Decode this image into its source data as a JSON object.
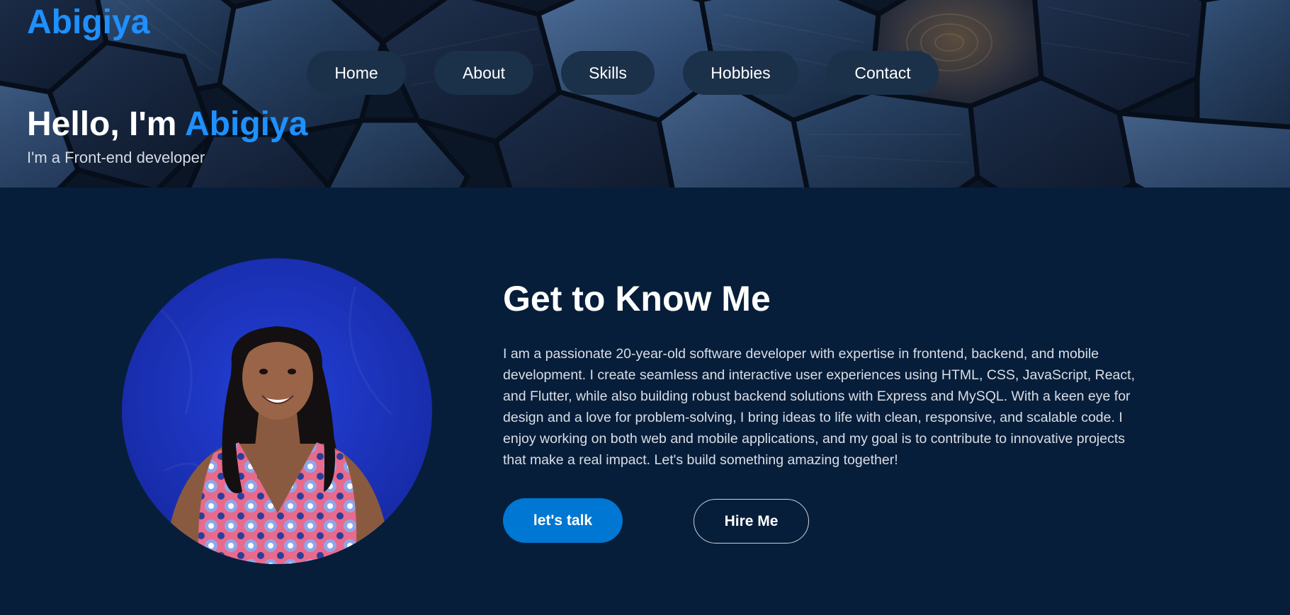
{
  "header": {
    "logo": "Abigiya",
    "nav": [
      {
        "label": "Home"
      },
      {
        "label": "About"
      },
      {
        "label": "Skills"
      },
      {
        "label": "Hobbies"
      },
      {
        "label": "Contact"
      }
    ],
    "hero_greeting": "Hello, I'm ",
    "hero_name": "Abigiya",
    "hero_subtitle": "I'm a Front-end developer"
  },
  "about": {
    "heading": "Get to Know Me",
    "body": "I am a passionate 20-year-old software developer with expertise in frontend, backend, and mobile development. I create seamless and interactive user experiences using HTML, CSS, JavaScript, React, and Flutter, while also building robust backend solutions with Express and MySQL. With a keen eye for design and a love for problem-solving, I bring ideas to life with clean, responsive, and scalable code. I enjoy working on both web and mobile applications, and my goal is to contribute to innovative projects that make a real impact. Let's build something amazing together!",
    "primary_button": "let's talk",
    "secondary_button": "Hire Me"
  },
  "colors": {
    "accent": "#1e90ff",
    "page_background": "#071e3a",
    "nav_pill": "#1b3049",
    "primary_button": "#0077d2",
    "portrait_background": "#1a2fbf"
  }
}
